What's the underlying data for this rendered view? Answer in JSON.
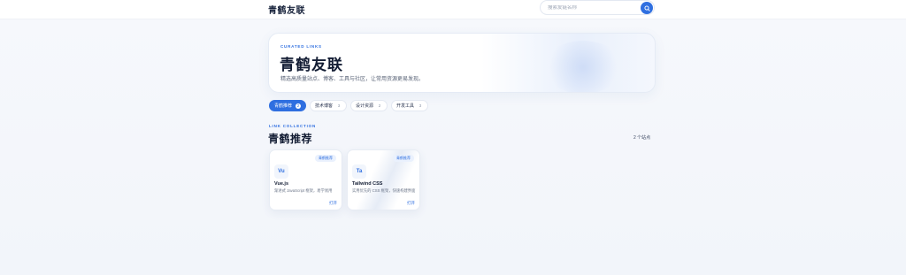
{
  "header": {
    "brand": "青鹤友联",
    "search_placeholder": "搜索友链名称"
  },
  "hero": {
    "kicker": "CURATED LINKS",
    "title": "青鹤友联",
    "description": "精选高质量站点、博客、工具与社区，让常用资源更易发现。"
  },
  "tabs": [
    {
      "label": "青鹤推荐",
      "count": "2",
      "active": true
    },
    {
      "label": "技术博客",
      "count": "3",
      "active": false
    },
    {
      "label": "设计资源",
      "count": "2",
      "active": false
    },
    {
      "label": "开发工具",
      "count": "3",
      "active": false
    }
  ],
  "section": {
    "kicker": "LINK COLLECTION",
    "title": "青鹤推荐",
    "count_text": "2 个站点"
  },
  "cards": [
    {
      "badge": "青鹤推荐",
      "icon_text": "Vu",
      "name": "Vue.js",
      "description": "渐进式 JavaScript 框架，易学易用",
      "open_label": "打开"
    },
    {
      "badge": "青鹤推荐",
      "icon_text": "Ta",
      "name": "Tailwind CSS",
      "description": "实用优先的 CSS 框架，快速构建界面",
      "open_label": "打开"
    }
  ],
  "colors": {
    "accent": "#2f6fe0",
    "background": "#f4f6fa",
    "text": "#121c33"
  }
}
